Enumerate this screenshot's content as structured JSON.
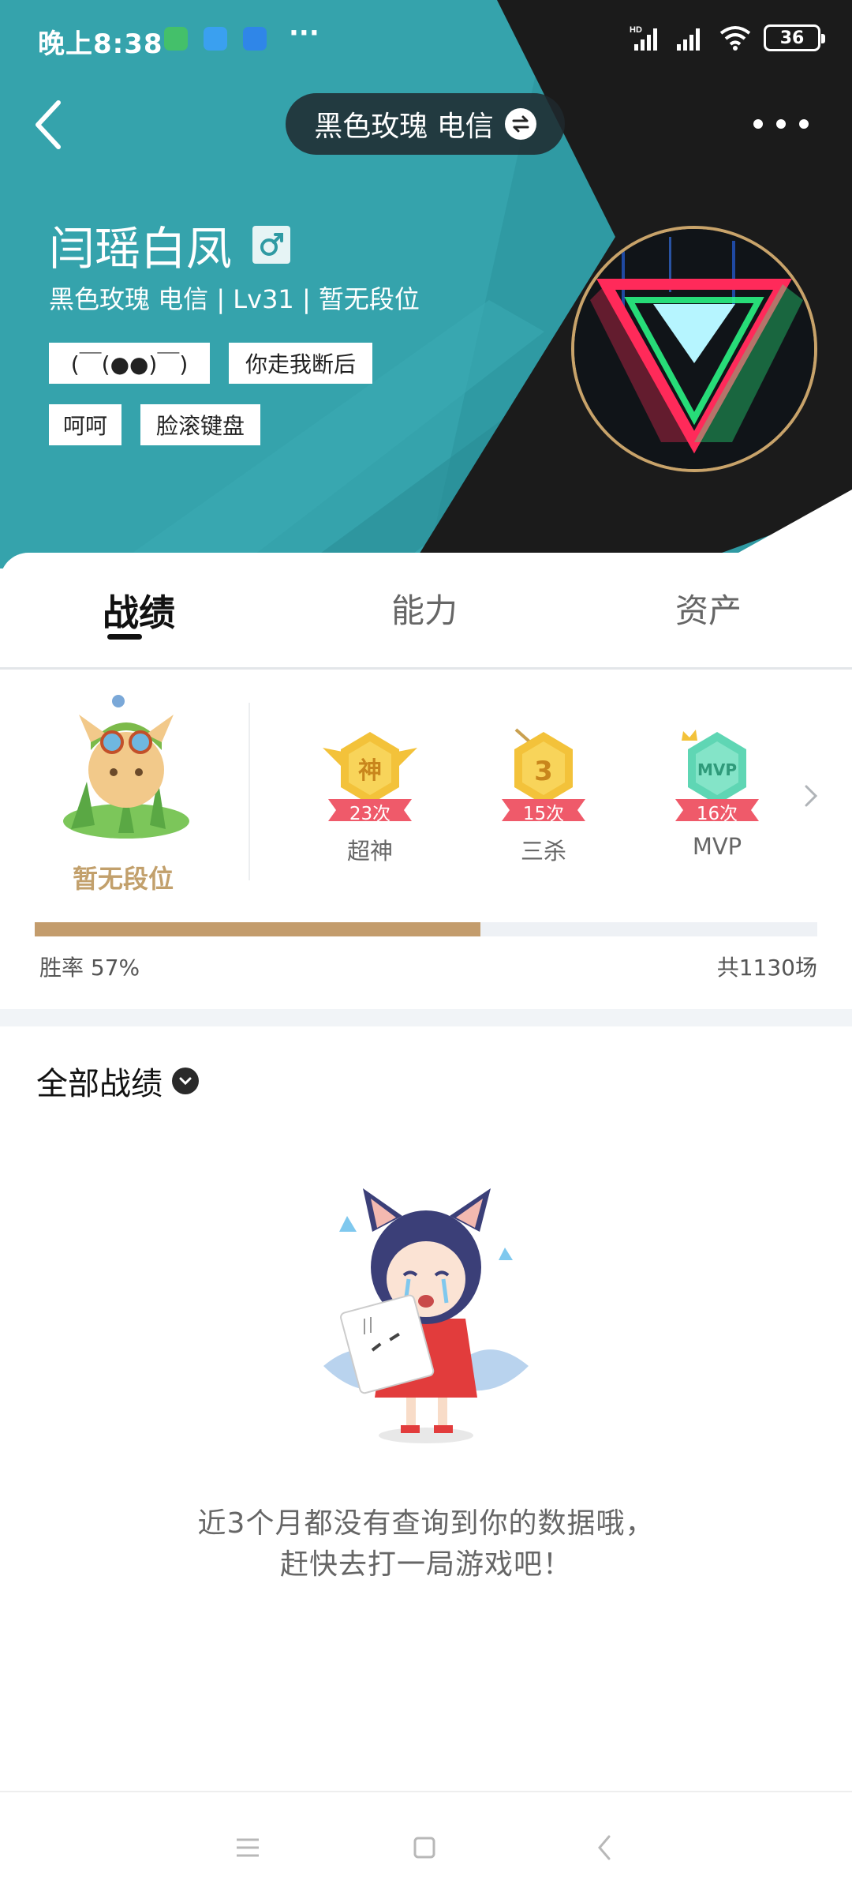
{
  "status_bar": {
    "time": "晚上8:38",
    "dots": "···",
    "network_label": "HD",
    "battery": "36"
  },
  "header": {
    "server_label": "黑色玫瑰 电信"
  },
  "profile": {
    "name": "闫瑶白凤",
    "meta": "黑色玫瑰 电信 | Lv31 | 暂无段位",
    "tags": [
      "(￣(●●)￣)",
      "你走我断后",
      "呵呵",
      "脸滚键盘"
    ]
  },
  "tabs": [
    {
      "label": "战绩"
    },
    {
      "label": "能力"
    },
    {
      "label": "资产"
    }
  ],
  "summary": {
    "rank_label": "暂无段位",
    "badges": [
      {
        "icon_text": "神",
        "count": "23次",
        "label": "超神"
      },
      {
        "icon_text": "3",
        "count": "15次",
        "label": "三杀"
      },
      {
        "icon_text": "MVP",
        "count": "16次",
        "label": "MVP"
      }
    ],
    "winrate_text": "胜率   57%",
    "winrate_fraction": 0.57,
    "total_games": "共1130场"
  },
  "records": {
    "title": "全部战绩",
    "empty_line1": "近3个月都没有查询到你的数据哦，",
    "empty_line2": "赶快去打一局游戏吧！"
  },
  "colors": {
    "teal": "#2f9aa3",
    "dark": "#1b1b1b",
    "gold": "#c39c6c",
    "badge_gold": "#f3c23a",
    "badge_red": "#ef5a6a",
    "badge_green": "#5fd6b4"
  },
  "icons": {
    "back": "back-arrow-icon",
    "swap": "swap-icon",
    "more": "more-icon",
    "gender": "male-icon",
    "dropdown": "chevron-down-icon"
  }
}
